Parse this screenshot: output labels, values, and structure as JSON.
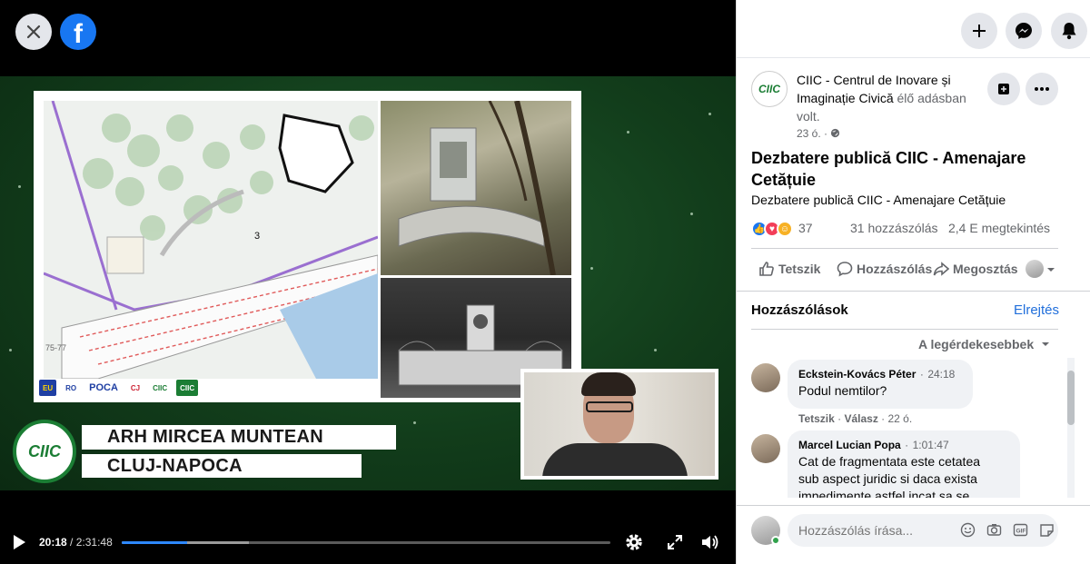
{
  "video": {
    "presenter_name": "ARH MIRCEA MUNTEAN",
    "presenter_location": "CLUJ-NAPOCA",
    "ciic_badge": "CIIC",
    "slide_logos": [
      "EU",
      "RO",
      "POCA",
      "CJ",
      "CIIC",
      "CIIC"
    ],
    "time_current": "20:18",
    "time_separator": "/",
    "time_total": "2:31:48",
    "progress_fraction": 0.134,
    "buffer_fraction": 0.26,
    "icons": [
      "close-icon",
      "facebook-logo",
      "play-icon",
      "settings-icon",
      "fullscreen-icon",
      "volume-icon"
    ]
  },
  "topbar": {
    "icons": [
      "plus-icon",
      "messenger-icon",
      "bell-icon"
    ]
  },
  "post": {
    "page_name": "CIIC - Centrul de Inovare și Imaginație Civică",
    "live_text": "élő adásban volt.",
    "time": "23 ó. ·",
    "title": "Dezbatere publică CIIC - Amenajare Cetățuie",
    "subtitle": "Dezbatere publică CIIC - Amenajare Cetățuie",
    "reactions_count": "37",
    "comments_count": "31 hozzászólás",
    "views": "2,4 E megtekintés",
    "actions": {
      "like": "Tetszik",
      "comment": "Hozzászólás",
      "share": "Megosztás"
    }
  },
  "comments_section": {
    "heading": "Hozzászólások",
    "hide_label": "Elrejtés",
    "sort_label": "A legérdekesebbek",
    "items": [
      {
        "author": "Eckstein-Kovács Péter",
        "time": "24:18",
        "text": "Podul nemtilor?",
        "like": "Tetszik",
        "reply": "Válasz",
        "age": "22 ó."
      },
      {
        "author": "Marcel Lucian Popa",
        "time": "1:01:47",
        "text": "Cat de fragmentata este cetatea sub aspect juridic si daca exista impedimente astfel incat sa se si"
      }
    ],
    "compose_placeholder": "Hozzászólás írása..."
  },
  "colors": {
    "accent": "#1877f2",
    "link": "#216fdb",
    "brand_green": "#1b7d34"
  }
}
